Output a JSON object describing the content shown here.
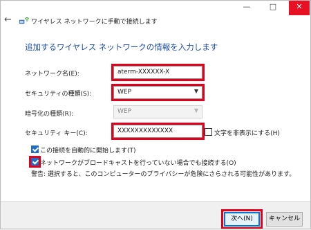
{
  "window": {
    "title": "ワイヤレス ネットワークに手動で接続します",
    "minimize_glyph": "—",
    "maximize_glyph": "□",
    "close_glyph": "✕",
    "back_glyph": "←"
  },
  "heading": "追加するワイヤレス ネットワークの情報を入力します",
  "form": {
    "network_name": {
      "label": "ネットワーク名(E):",
      "value": "aterm-XXXXXX-X"
    },
    "security_type": {
      "label": "セキュリティの種類(S):",
      "value": "WEP"
    },
    "encryption_type": {
      "label": "暗号化の種類(R):",
      "value": "WEP",
      "disabled": true
    },
    "security_key": {
      "label": "セキュリティ キー(C):",
      "value": "XXXXXXXXXXXXX"
    },
    "hide_chars": {
      "label": "文字を非表示にする(H)",
      "checked": false
    }
  },
  "options": {
    "auto_start": {
      "label": "この接続を自動的に開始します(T)",
      "checked": true
    },
    "connect_hidden": {
      "label": "ネットワークがブロードキャストを行っていない場合でも接続する(O)",
      "checked": true
    },
    "warning": "警告: 選択すると、このコンピューターのプライバシーが危険にさらされる可能性があります。"
  },
  "buttons": {
    "next": "次へ(N)",
    "cancel": "キャンセル"
  },
  "colors": {
    "heading": "#1e4fa3",
    "highlight": "#e0001b",
    "accent": "#0078d7"
  },
  "icons": {
    "back": "back-arrow-icon",
    "wifi": "wifi-network-icon",
    "dropdown": "chevron-down-icon"
  }
}
